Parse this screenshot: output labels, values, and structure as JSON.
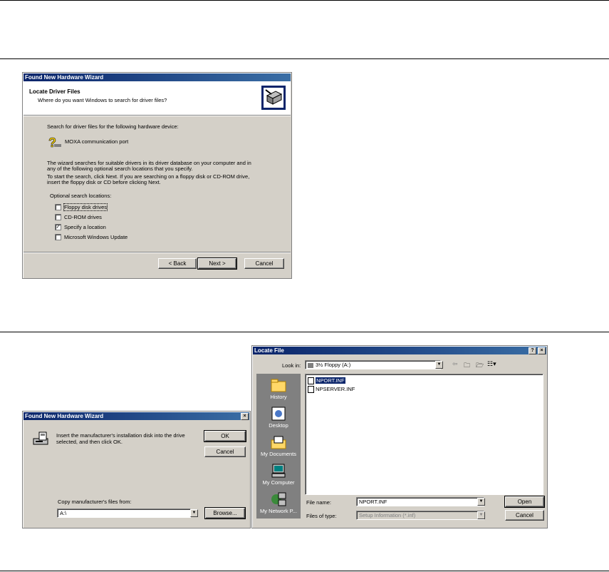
{
  "wizard": {
    "title": "Found New Hardware Wizard",
    "heading": "Locate Driver Files",
    "subheading": "Where do you want Windows to search for driver files?",
    "search_for": "Search for driver files for the following hardware device:",
    "device_name": "MOXA communication port",
    "para1_line1": "The wizard searches for suitable drivers in its driver database on your computer and in",
    "para1_line2": "any of the following optional search locations that you specify.",
    "para2_line1": "To start the search, click Next. If you are searching on a floppy disk or CD-ROM drive,",
    "para2_line2": "insert the floppy disk or CD before clicking Next.",
    "optional_label": "Optional search locations:",
    "options": [
      {
        "label": "Floppy disk drives",
        "checked": false
      },
      {
        "label": "CD-ROM drives",
        "checked": false
      },
      {
        "label": "Specify a location",
        "checked": true
      },
      {
        "label": "Microsoft Windows Update",
        "checked": false
      }
    ],
    "back_label": "< Back",
    "next_label": "Next >",
    "cancel_label": "Cancel"
  },
  "insert_disk": {
    "title": "Found New Hardware Wizard",
    "message_line1": "Insert the manufacturer's installation disk into the drive",
    "message_line2": "selected, and then click OK.",
    "ok_label": "OK",
    "cancel_label": "Cancel",
    "copy_label": "Copy manufacturer's files from:",
    "copy_value": "A:\\",
    "browse_label": "Browse..."
  },
  "locate_file": {
    "title": "Locate File",
    "look_in_label": "Look in:",
    "look_in_value": "3½ Floppy (A:)",
    "places": [
      "History",
      "Desktop",
      "My Documents",
      "My Computer",
      "My Network P..."
    ],
    "files": [
      "NPORT.INF",
      "NPSERVER.INF"
    ],
    "file_name_label": "File name:",
    "file_name_value": "NPORT.INF",
    "file_type_label": "Files of type:",
    "file_type_value": "Setup Information (*.inf)",
    "open_label": "Open",
    "cancel_label": "Cancel"
  }
}
